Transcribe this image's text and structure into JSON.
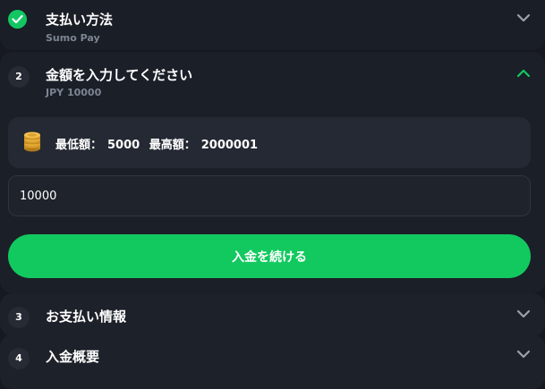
{
  "colors": {
    "accent": "#12c95f",
    "check": "#12c664",
    "background": "#161a20",
    "panel": "#1b1f28",
    "card": "#242933",
    "muted_text": "#7d8593"
  },
  "steps": [
    {
      "marker": "check-icon",
      "title": "支払い方法",
      "subtitle": "Sumo Pay",
      "state": "collapsed"
    },
    {
      "number": "2",
      "title": "金額を入力してください",
      "subtitle": "JPY 10000",
      "state": "expanded"
    },
    {
      "number": "3",
      "title": "お支払い情報",
      "state": "collapsed"
    },
    {
      "number": "4",
      "title": "入金概要",
      "state": "collapsed"
    }
  ],
  "limits": {
    "icon": "coin-stack-icon",
    "min_label": "最低額：",
    "min_value": "5000",
    "max_label": "最高額：",
    "max_value": "2000001"
  },
  "amount_input": {
    "value": "10000"
  },
  "continue_button": {
    "label": "入金を続ける"
  }
}
